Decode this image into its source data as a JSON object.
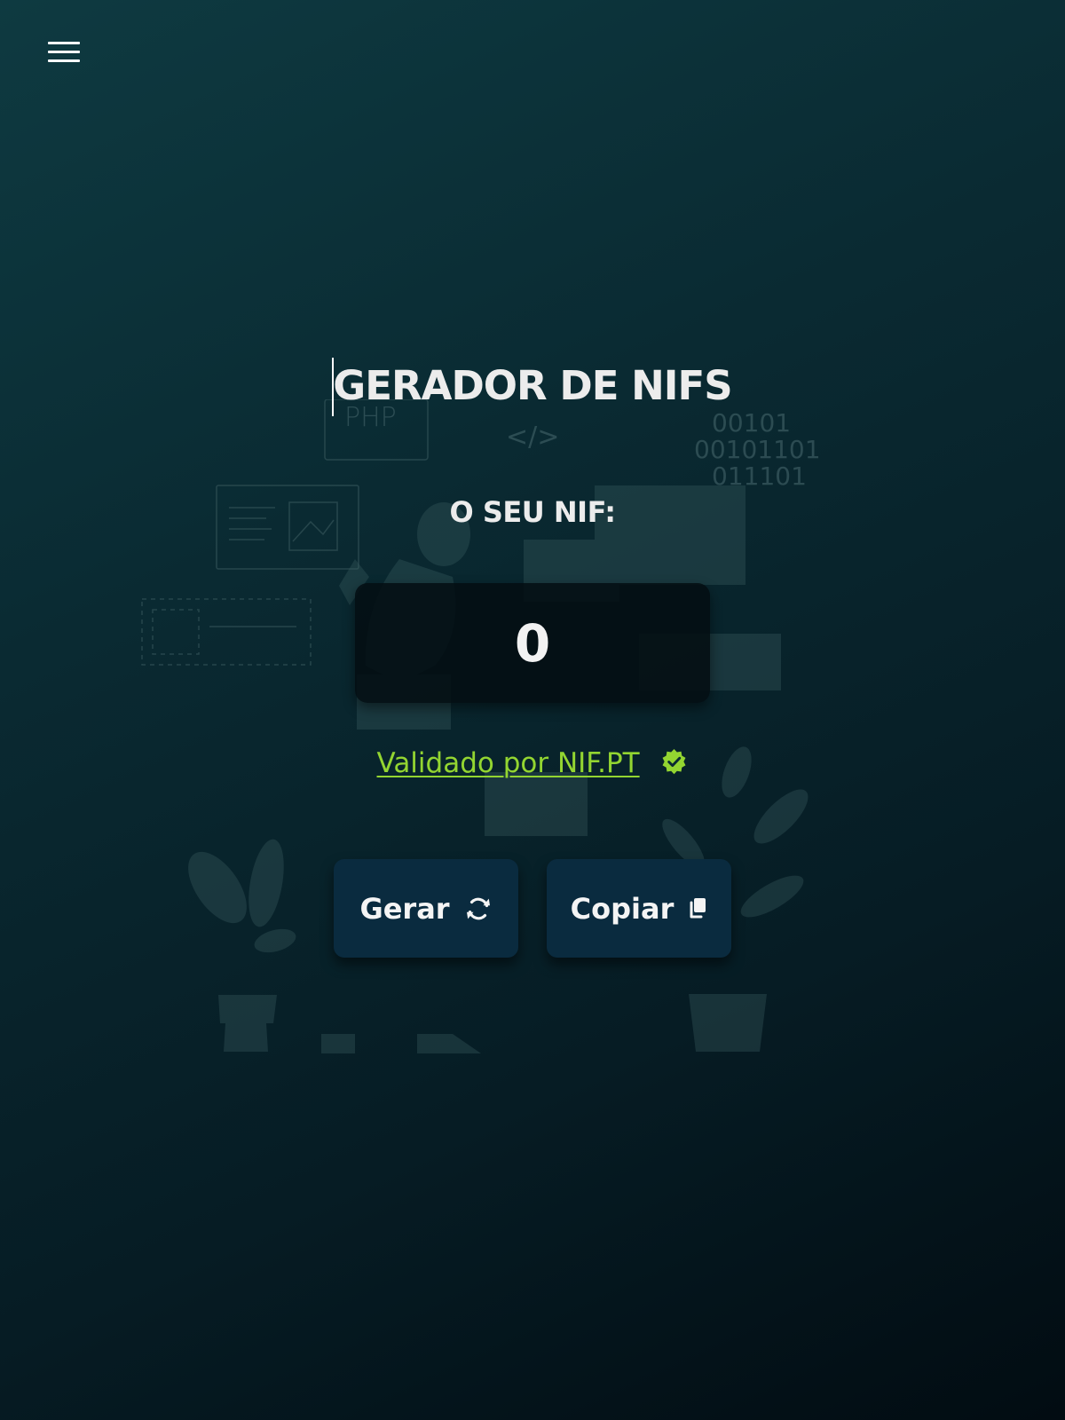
{
  "menu": {
    "icon": "hamburger-menu-icon"
  },
  "header": {
    "title": "GERADOR DE NIFS"
  },
  "nif": {
    "label": "O SEU NIF:",
    "value": "0"
  },
  "validation": {
    "link_text": "Validado por NIF.PT",
    "icon": "verified-badge-icon"
  },
  "actions": {
    "generate_label": "Gerar",
    "generate_icon": "refresh-icon",
    "copy_label": "Copiar",
    "copy_icon": "copy-icon"
  },
  "background": {
    "illustration_text": [
      "PHP",
      "</>",
      "00101",
      "00101101",
      "011101"
    ]
  },
  "colors": {
    "accent_green": "#93d531",
    "button_bg": "#0a2b3f",
    "nif_box_bg": "#030e12"
  }
}
